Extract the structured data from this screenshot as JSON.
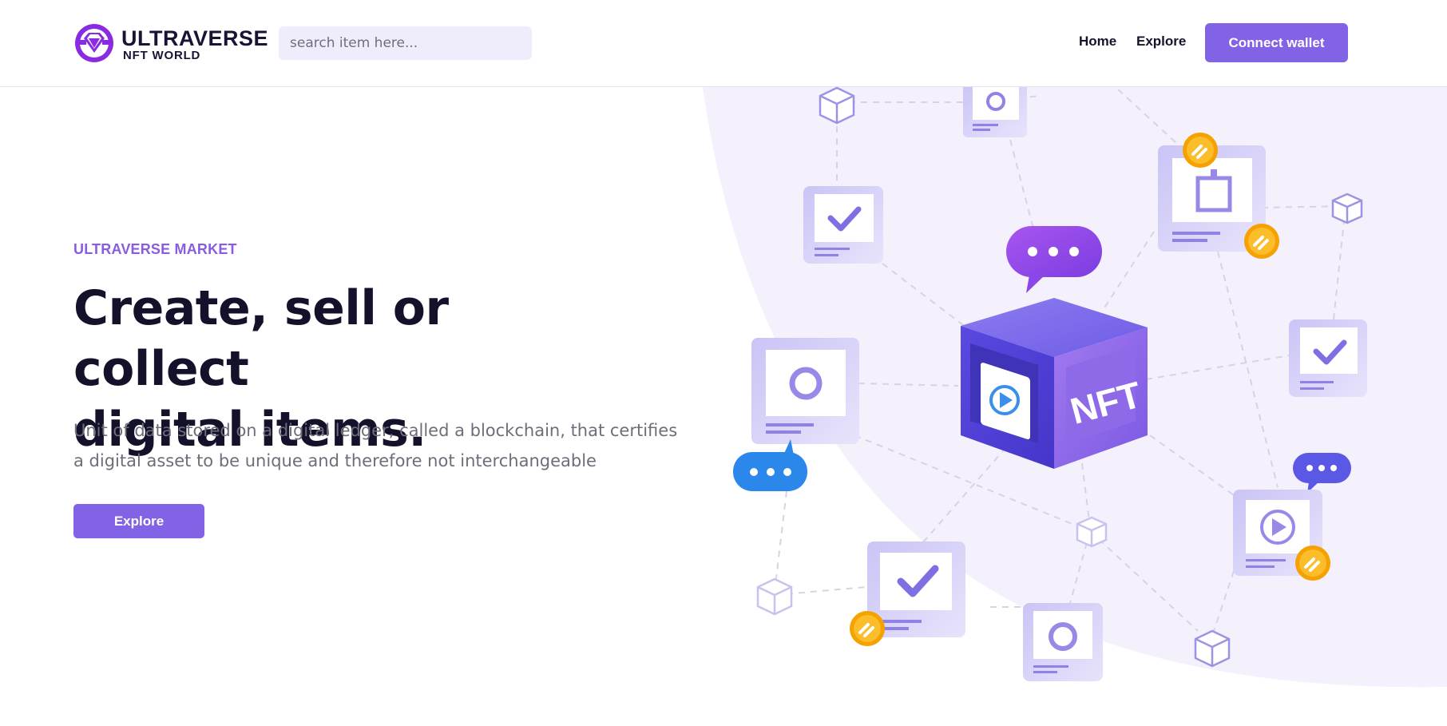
{
  "header": {
    "logo": {
      "line1": "ULTRAVERSE",
      "line2": "NFT WORLD"
    },
    "search": {
      "placeholder": "search item here..."
    },
    "nav": {
      "home": "Home",
      "explore": "Explore"
    },
    "connect_label": "Connect wallet"
  },
  "hero": {
    "eyebrow": "ULTRAVERSE MARKET",
    "headline_line1": "Create, sell or collect",
    "headline_line2": "digital items.",
    "description": "Unit of data stored on a digital ledger, called a blockchain, that certifies a digital asset to be unique and therefore not interchangeable",
    "explore_label": "Explore"
  },
  "illustration": {
    "cube_label": "NFT",
    "icons": [
      "nft-cube-icon",
      "chat-bubble-icon",
      "check-card-icon",
      "circle-card-icon",
      "play-card-icon",
      "square-card-icon",
      "link-coin-icon",
      "wireframe-cube-icon"
    ]
  },
  "colors": {
    "accent": "#8363e5",
    "eyebrow": "#8a5ce0",
    "headline": "#14112b",
    "description": "#6e6e7a",
    "search_bg": "#efedfb",
    "hero_blob": "#f4f1fd",
    "coin": "#f5a100",
    "chat_blue": "#2c87ea",
    "chat_purple": "#9645e4"
  }
}
